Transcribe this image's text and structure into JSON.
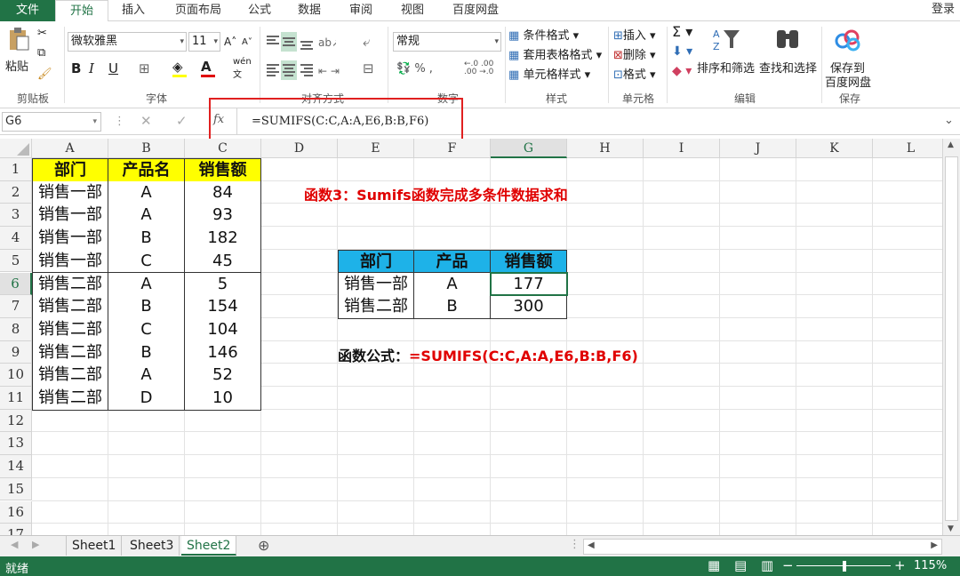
{
  "tabs": {
    "file": "文件",
    "home": "开始",
    "insert": "插入",
    "page_layout": "页面布局",
    "formulas": "公式",
    "data": "数据",
    "review": "审阅",
    "view": "视图",
    "baidu": "百度网盘",
    "login": "登录"
  },
  "ribbon": {
    "paste": "粘贴",
    "font_name": "微软雅黑",
    "font_size": "11",
    "number_format": "常规",
    "cond_format": "条件格式",
    "table_format": "套用表格格式",
    "cell_style": "单元格样式",
    "insert": "插入",
    "delete": "删除",
    "format": "格式",
    "sort_filter": "排序和筛选",
    "find_select": "查找和选择",
    "save_to": "保存到",
    "baidu_disk": "百度网盘",
    "groups": {
      "clipboard": "剪贴板",
      "font": "字体",
      "alignment": "对齐方式",
      "number": "数字",
      "styles": "样式",
      "cells": "单元格",
      "editing": "编辑",
      "save": "保存"
    }
  },
  "formula_bar": {
    "name_box": "G6",
    "fx": "fx",
    "formula": "=SUMIFS(C:C,A:A,E6,B:B,F6)"
  },
  "columns": [
    "A",
    "B",
    "C",
    "D",
    "E",
    "F",
    "G",
    "H",
    "I",
    "J",
    "K",
    "L"
  ],
  "rows": [
    "1",
    "2",
    "3",
    "4",
    "5",
    "6",
    "7",
    "8",
    "9",
    "10",
    "11",
    "12",
    "13",
    "14",
    "15",
    "16",
    "17"
  ],
  "table1": {
    "headers": [
      "部门",
      "产品名",
      "销售额"
    ],
    "rows": [
      [
        "销售一部",
        "A",
        "84"
      ],
      [
        "销售一部",
        "A",
        "93"
      ],
      [
        "销售一部",
        "B",
        "182"
      ],
      [
        "销售一部",
        "C",
        "45"
      ],
      [
        "销售二部",
        "A",
        "5"
      ],
      [
        "销售二部",
        "B",
        "154"
      ],
      [
        "销售二部",
        "C",
        "104"
      ],
      [
        "销售二部",
        "B",
        "146"
      ],
      [
        "销售二部",
        "A",
        "52"
      ],
      [
        "销售二部",
        "D",
        "10"
      ]
    ]
  },
  "title_note": "函数3：Sumifs函数完成多条件数据求和",
  "table2": {
    "headers": [
      "部门",
      "产品",
      "销售额"
    ],
    "rows": [
      [
        "销售一部",
        "A",
        "177"
      ],
      [
        "销售二部",
        "B",
        "300"
      ]
    ]
  },
  "formula_note": {
    "label": "函数公式：",
    "formula": "=SUMIFS(C:C,A:A,E6,B:B,F6)"
  },
  "sheets": [
    "Sheet1",
    "Sheet3",
    "Sheet2"
  ],
  "active_sheet": "Sheet2",
  "status": {
    "ready": "就绪",
    "zoom": "115%"
  },
  "colors": {
    "accent": "#217346",
    "header_yellow": "#ffff00",
    "header_blue": "#1eb2e8",
    "note_red": "#e00000",
    "highlight_box": "#e02020"
  }
}
